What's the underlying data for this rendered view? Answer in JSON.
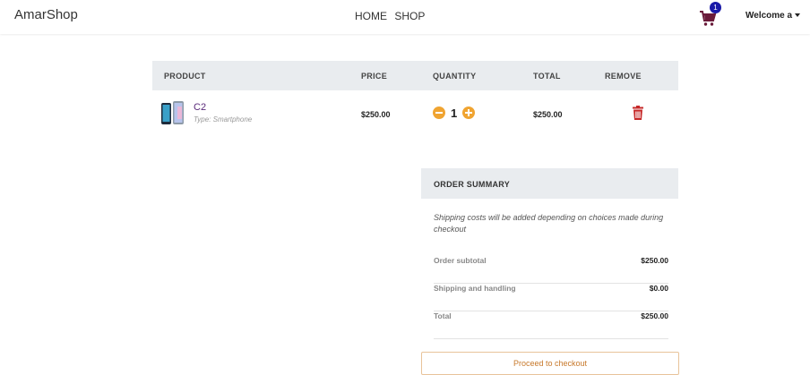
{
  "nav": {
    "brand": "AmarShop",
    "links": [
      "HOME",
      "SHOP"
    ],
    "cart_count": "1",
    "welcome": "Welcome a"
  },
  "table": {
    "headers": [
      "PRODUCT",
      "PRICE",
      "QUANTITY",
      "TOTAL",
      "REMOVE"
    ],
    "items": [
      {
        "name": "C2",
        "type": "Type: Smartphone",
        "price": "$250.00",
        "quantity": "1",
        "total": "$250.00"
      }
    ]
  },
  "summary": {
    "title": "ORDER SUMMARY",
    "note": "Shipping costs will be added depending on choices made during checkout",
    "rows": [
      {
        "label": "Order subtotal",
        "value": "$250.00"
      },
      {
        "label": "Shipping and handling",
        "value": "$0.00"
      },
      {
        "label": "Total",
        "value": "$250.00"
      }
    ],
    "checkout_label": "Proceed to checkout"
  },
  "colors": {
    "accent": "#f0a431",
    "trash": "#c62828",
    "cart": "#6a1b3a",
    "badge": "#1a1aa8"
  }
}
